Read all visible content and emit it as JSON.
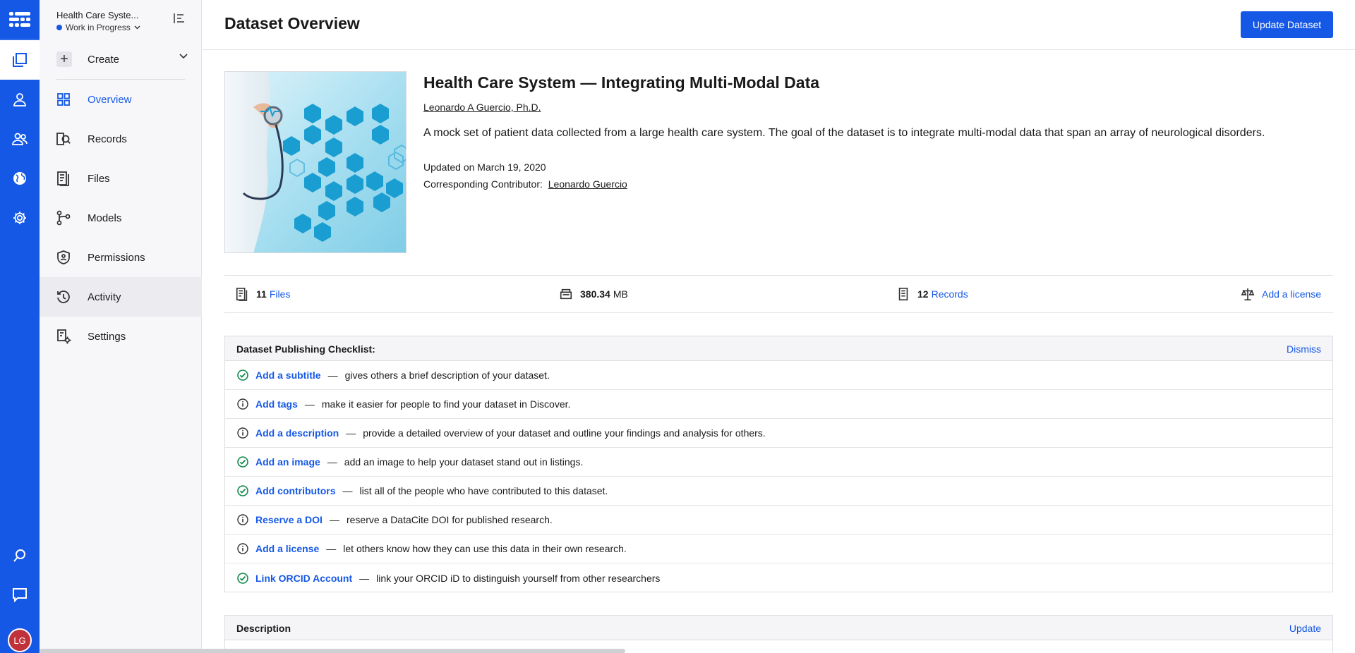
{
  "rail": {
    "avatar_initials": "LG",
    "colors": {
      "brand": "#1558e6",
      "avatar": "#c0313a"
    },
    "icons": [
      "logo-grid-icon",
      "datasets-icon",
      "person-icon",
      "team-icon",
      "globe-icon",
      "gear-icon",
      "search-icon",
      "chat-icon"
    ]
  },
  "sidebar": {
    "dataset_name": "Health Care Syste...",
    "status": "Work in Progress",
    "create_label": "Create",
    "items": [
      {
        "label": "Overview",
        "icon": "grid-icon",
        "active": true
      },
      {
        "label": "Records",
        "icon": "records-icon"
      },
      {
        "label": "Files",
        "icon": "files-icon"
      },
      {
        "label": "Models",
        "icon": "models-icon"
      },
      {
        "label": "Permissions",
        "icon": "shield-icon"
      },
      {
        "label": "Activity",
        "icon": "activity-icon",
        "hovered": true
      },
      {
        "label": "Settings",
        "icon": "settings-icon"
      }
    ]
  },
  "header": {
    "title": "Dataset Overview",
    "update_button": "Update Dataset"
  },
  "dataset": {
    "title": "Health Care System — Integrating Multi-Modal Data",
    "author": "Leonardo A Guercio, Ph.D.",
    "description": "A mock set of patient data collected from a large health care system. The goal of the dataset is to integrate multi-modal data that span an array of neurological disorders.",
    "updated": "Updated on March 19, 2020",
    "contributor_label": "Corresponding Contributor:",
    "contributor_name": "Leonardo Guercio"
  },
  "stats": {
    "files_count": "11",
    "files_label": "Files",
    "size_value": "380.34",
    "size_unit": "MB",
    "records_count": "12",
    "records_label": "Records",
    "license_label": "Add a license"
  },
  "checklist": {
    "title": "Dataset Publishing Checklist:",
    "dismiss": "Dismiss",
    "items": [
      {
        "link": "Add a subtitle",
        "text": "gives others a brief description of your dataset.",
        "done": true
      },
      {
        "link": "Add tags",
        "text": "make it easier for people to find your dataset in Discover.",
        "done": false
      },
      {
        "link": "Add a description",
        "text": "provide a detailed overview of your dataset and outline your findings and analysis for others.",
        "done": false
      },
      {
        "link": "Add an image",
        "text": "add an image to help your dataset stand out in listings.",
        "done": true
      },
      {
        "link": "Add contributors",
        "text": "list all of the people who have contributed to this dataset.",
        "done": true
      },
      {
        "link": "Reserve a DOI",
        "text": "reserve a DataCite DOI for published research.",
        "done": false
      },
      {
        "link": "Add a license",
        "text": "let others know how they can use this data in their own research.",
        "done": false
      },
      {
        "link": "Link ORCID Account",
        "text": "link your ORCID iD to distinguish yourself from other researchers",
        "done": true
      }
    ]
  },
  "description_section": {
    "title": "Description",
    "update": "Update"
  }
}
